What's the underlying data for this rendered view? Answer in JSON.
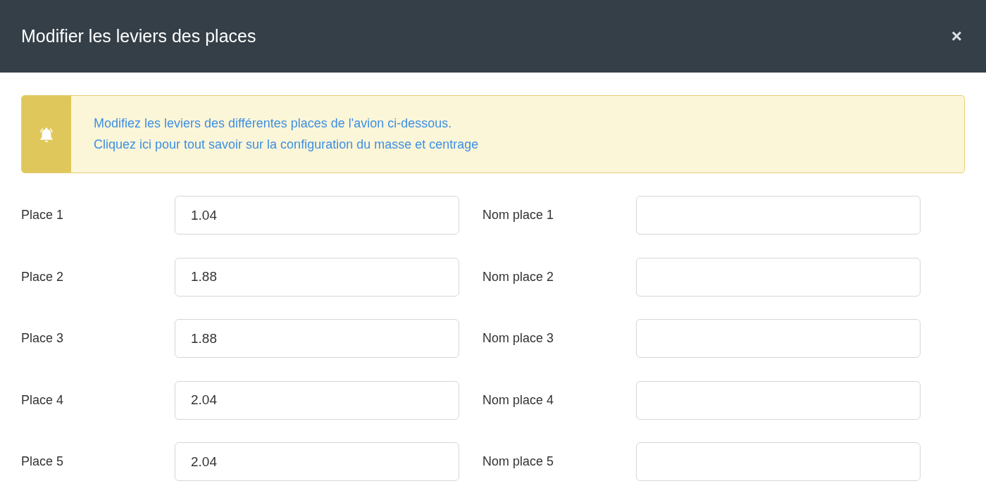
{
  "dialog": {
    "title": "Modifier les leviers des places",
    "close": "×"
  },
  "alert": {
    "message": "Modifiez les leviers des différentes places de l'avion ci-dessous.",
    "link": "Cliquez ici pour tout savoir sur la configuration du masse et centrage"
  },
  "places": [
    {
      "label": "Place 1",
      "value": "1.04",
      "name_label": "Nom place 1"
    },
    {
      "label": "Place 2",
      "value": "1.88",
      "name_label": "Nom place 2"
    },
    {
      "label": "Place 3",
      "value": "1.88",
      "name_label": "Nom place 3"
    },
    {
      "label": "Place 4",
      "value": "2.04",
      "name_label": "Nom place 4"
    },
    {
      "label": "Place 5",
      "value": "2.04",
      "name_label": "Nom place 5"
    }
  ]
}
